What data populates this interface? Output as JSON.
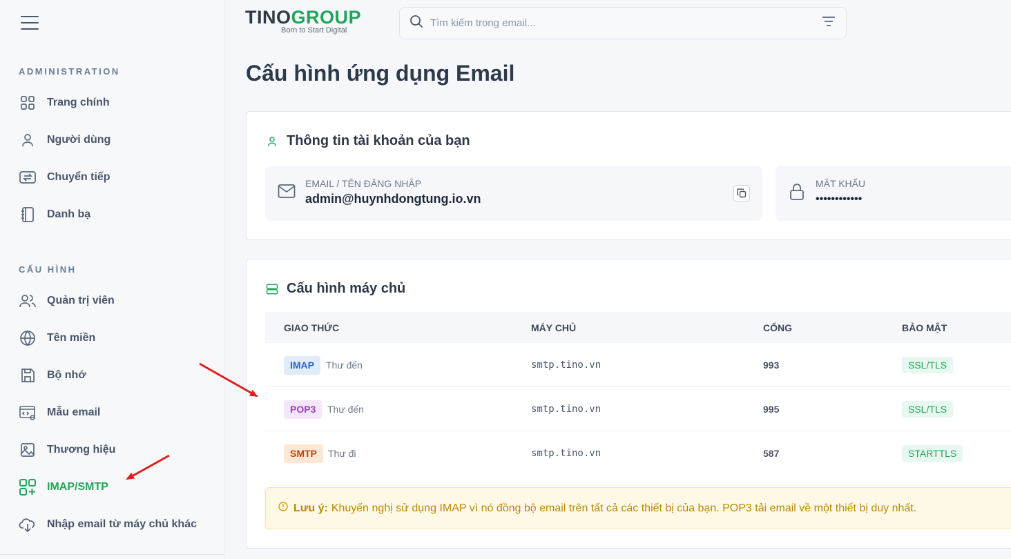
{
  "sidebar": {
    "sections": [
      {
        "label": "ADMINISTRATION",
        "items": [
          {
            "label": "Trang chính",
            "icon": "dashboard-grid-icon"
          },
          {
            "label": "Người dùng",
            "icon": "user-icon"
          },
          {
            "label": "Chuyển tiếp",
            "icon": "forward-arrows-icon"
          },
          {
            "label": "Danh bạ",
            "icon": "address-book-icon"
          }
        ]
      },
      {
        "label": "CẤU HÌNH",
        "items": [
          {
            "label": "Quản trị viên",
            "icon": "users-icon"
          },
          {
            "label": "Tên miền",
            "icon": "globe-icon"
          },
          {
            "label": "Bộ nhớ",
            "icon": "floppy-disk-icon"
          },
          {
            "label": "Mẫu email",
            "icon": "template-icon"
          },
          {
            "label": "Thương hiệu",
            "icon": "image-icon"
          },
          {
            "label": "IMAP/SMTP",
            "icon": "apps-plus-icon",
            "active": true
          },
          {
            "label": "Nhập email từ máy chủ khác",
            "icon": "cloud-download-icon"
          }
        ]
      }
    ]
  },
  "header": {
    "logo_main": "TINO",
    "logo_accent": "GROUP",
    "logo_tagline": "Born to Start Digital",
    "search_placeholder": "Tìm kiếm trong email..."
  },
  "page_title": "Cấu hình ứng dụng Email",
  "account": {
    "title": "Thông tin tài khoản của bạn",
    "email_label": "EMAIL / TÊN ĐĂNG NHẬP",
    "email_value": "admin@huynhdongtung.io.vn",
    "password_label": "MẬT KHẨU",
    "password_value": "••••••••••••"
  },
  "server": {
    "title": "Cấu hình máy chủ",
    "columns": [
      "GIAO THỨC",
      "MÁY CHỦ",
      "CỔNG",
      "BẢO MẬT"
    ],
    "rows": [
      {
        "protocol": "IMAP",
        "direction": "Thư đến",
        "host": "smtp.tino.vn",
        "port": "993",
        "security": "SSL/TLS",
        "bg": "#e1ecfb",
        "fg": "#2b63c9"
      },
      {
        "protocol": "POP3",
        "direction": "Thư đến",
        "host": "smtp.tino.vn",
        "port": "995",
        "security": "SSL/TLS",
        "bg": "#f4e6fb",
        "fg": "#9a3fc1"
      },
      {
        "protocol": "SMTP",
        "direction": "Thư đi",
        "host": "smtp.tino.vn",
        "port": "587",
        "security": "STARTTLS",
        "bg": "#fde8d6",
        "fg": "#c2410c"
      }
    ]
  },
  "note": {
    "label": "Lưu ý:",
    "text": "Khuyến nghị sử dụng IMAP vì nó đồng bộ email trên tất cả các thiết bị của bạn. POP3 tải email về một thiết bị duy nhất."
  },
  "colors": {
    "accent": "#22a55a",
    "annotation": "#e11d1d"
  }
}
